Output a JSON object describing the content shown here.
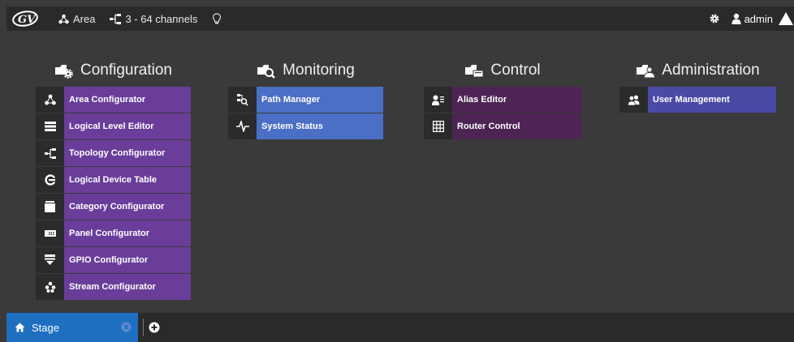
{
  "topbar": {
    "logo_text": "GV",
    "area_label": "Area",
    "channels_label": "3 - 64 channels",
    "user_label": "admin"
  },
  "columns": [
    {
      "title": "Configuration",
      "color": "#6a3d9a",
      "items": [
        {
          "label": "Area Configurator",
          "icon": "area-icon"
        },
        {
          "label": "Logical Level Editor",
          "icon": "stack-icon"
        },
        {
          "label": "Topology Configurator",
          "icon": "topology-icon"
        },
        {
          "label": "Logical Device Table",
          "icon": "device-table-icon"
        },
        {
          "label": "Category Configurator",
          "icon": "category-icon"
        },
        {
          "label": "Panel Configurator",
          "icon": "panel-icon"
        },
        {
          "label": "GPIO Configurator",
          "icon": "gpio-icon"
        },
        {
          "label": "Stream Configurator",
          "icon": "stream-icon"
        }
      ]
    },
    {
      "title": "Monitoring",
      "color": "#4a6fc4",
      "items": [
        {
          "label": "Path Manager",
          "icon": "path-manager-icon"
        },
        {
          "label": "System Status",
          "icon": "pulse-icon"
        }
      ]
    },
    {
      "title": "Control",
      "color": "#4e2455",
      "items": [
        {
          "label": "Alias Editor",
          "icon": "alias-icon"
        },
        {
          "label": "Router Control",
          "icon": "grid-icon"
        }
      ]
    },
    {
      "title": "Administration",
      "color": "#4a4aa6",
      "items": [
        {
          "label": "User Management",
          "icon": "users-icon"
        }
      ]
    }
  ],
  "bottombar": {
    "stage_tab_label": "Stage"
  }
}
